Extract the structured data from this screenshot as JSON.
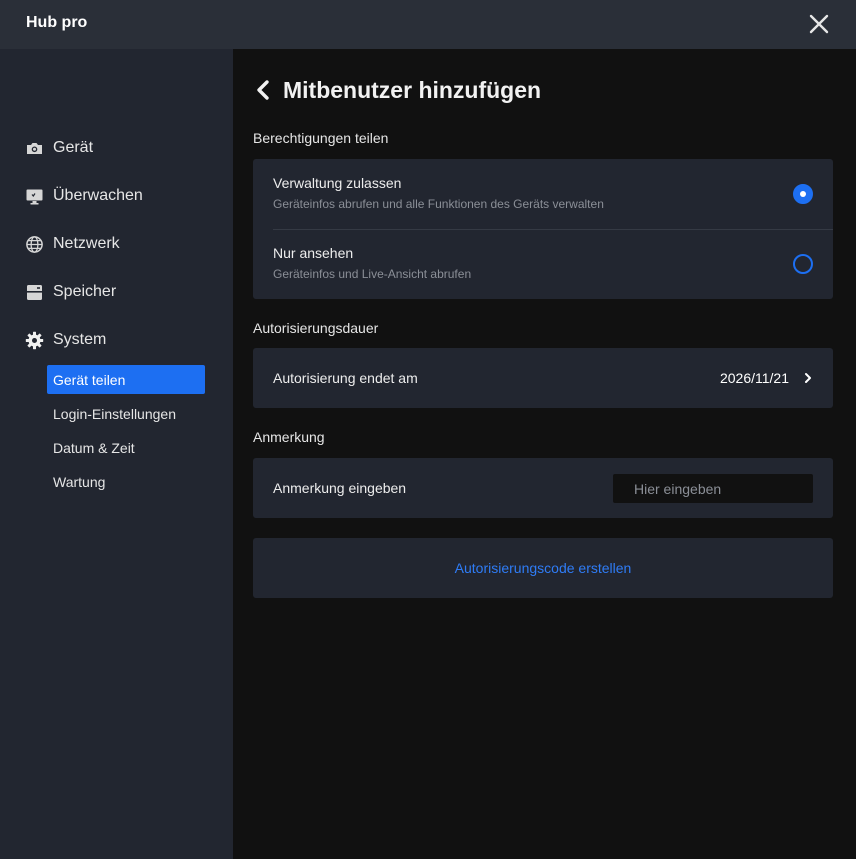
{
  "window": {
    "title": "Hub pro"
  },
  "sidebar": {
    "items": [
      {
        "label": "Gerät",
        "icon": "camera-icon"
      },
      {
        "label": "Überwachen",
        "icon": "monitor-icon"
      },
      {
        "label": "Netzwerk",
        "icon": "globe-icon"
      },
      {
        "label": "Speicher",
        "icon": "storage-icon"
      },
      {
        "label": "System",
        "icon": "gear-icon"
      }
    ],
    "system_subitems": [
      {
        "label": "Gerät teilen",
        "active": true
      },
      {
        "label": "Login-Einstellungen",
        "active": false
      },
      {
        "label": "Datum & Zeit",
        "active": false
      },
      {
        "label": "Wartung",
        "active": false
      }
    ]
  },
  "page": {
    "title": "Mitbenutzer hinzufügen",
    "permissions": {
      "section_label": "Berechtigungen teilen",
      "options": [
        {
          "title": "Verwaltung zulassen",
          "description": "Geräteinfos abrufen und alle Funktionen des Geräts verwalten",
          "selected": true
        },
        {
          "title": "Nur ansehen",
          "description": "Geräteinfos und Live-Ansicht abrufen",
          "selected": false
        }
      ]
    },
    "duration": {
      "section_label": "Autorisierungsdauer",
      "row_label": "Autorisierung endet am",
      "value": "2026/11/21"
    },
    "note": {
      "section_label": "Anmerkung",
      "row_label": "Anmerkung eingeben",
      "value": "",
      "placeholder": "Hier eingeben"
    },
    "action": {
      "label": "Autorisierungscode erstellen"
    }
  },
  "colors": {
    "accent": "#1d6ff2",
    "link": "#2f7cf6",
    "sidebar_bg": "#222630",
    "titlebar_bg": "#2a2f38",
    "card_bg": "#222630",
    "main_bg": "#111111"
  }
}
